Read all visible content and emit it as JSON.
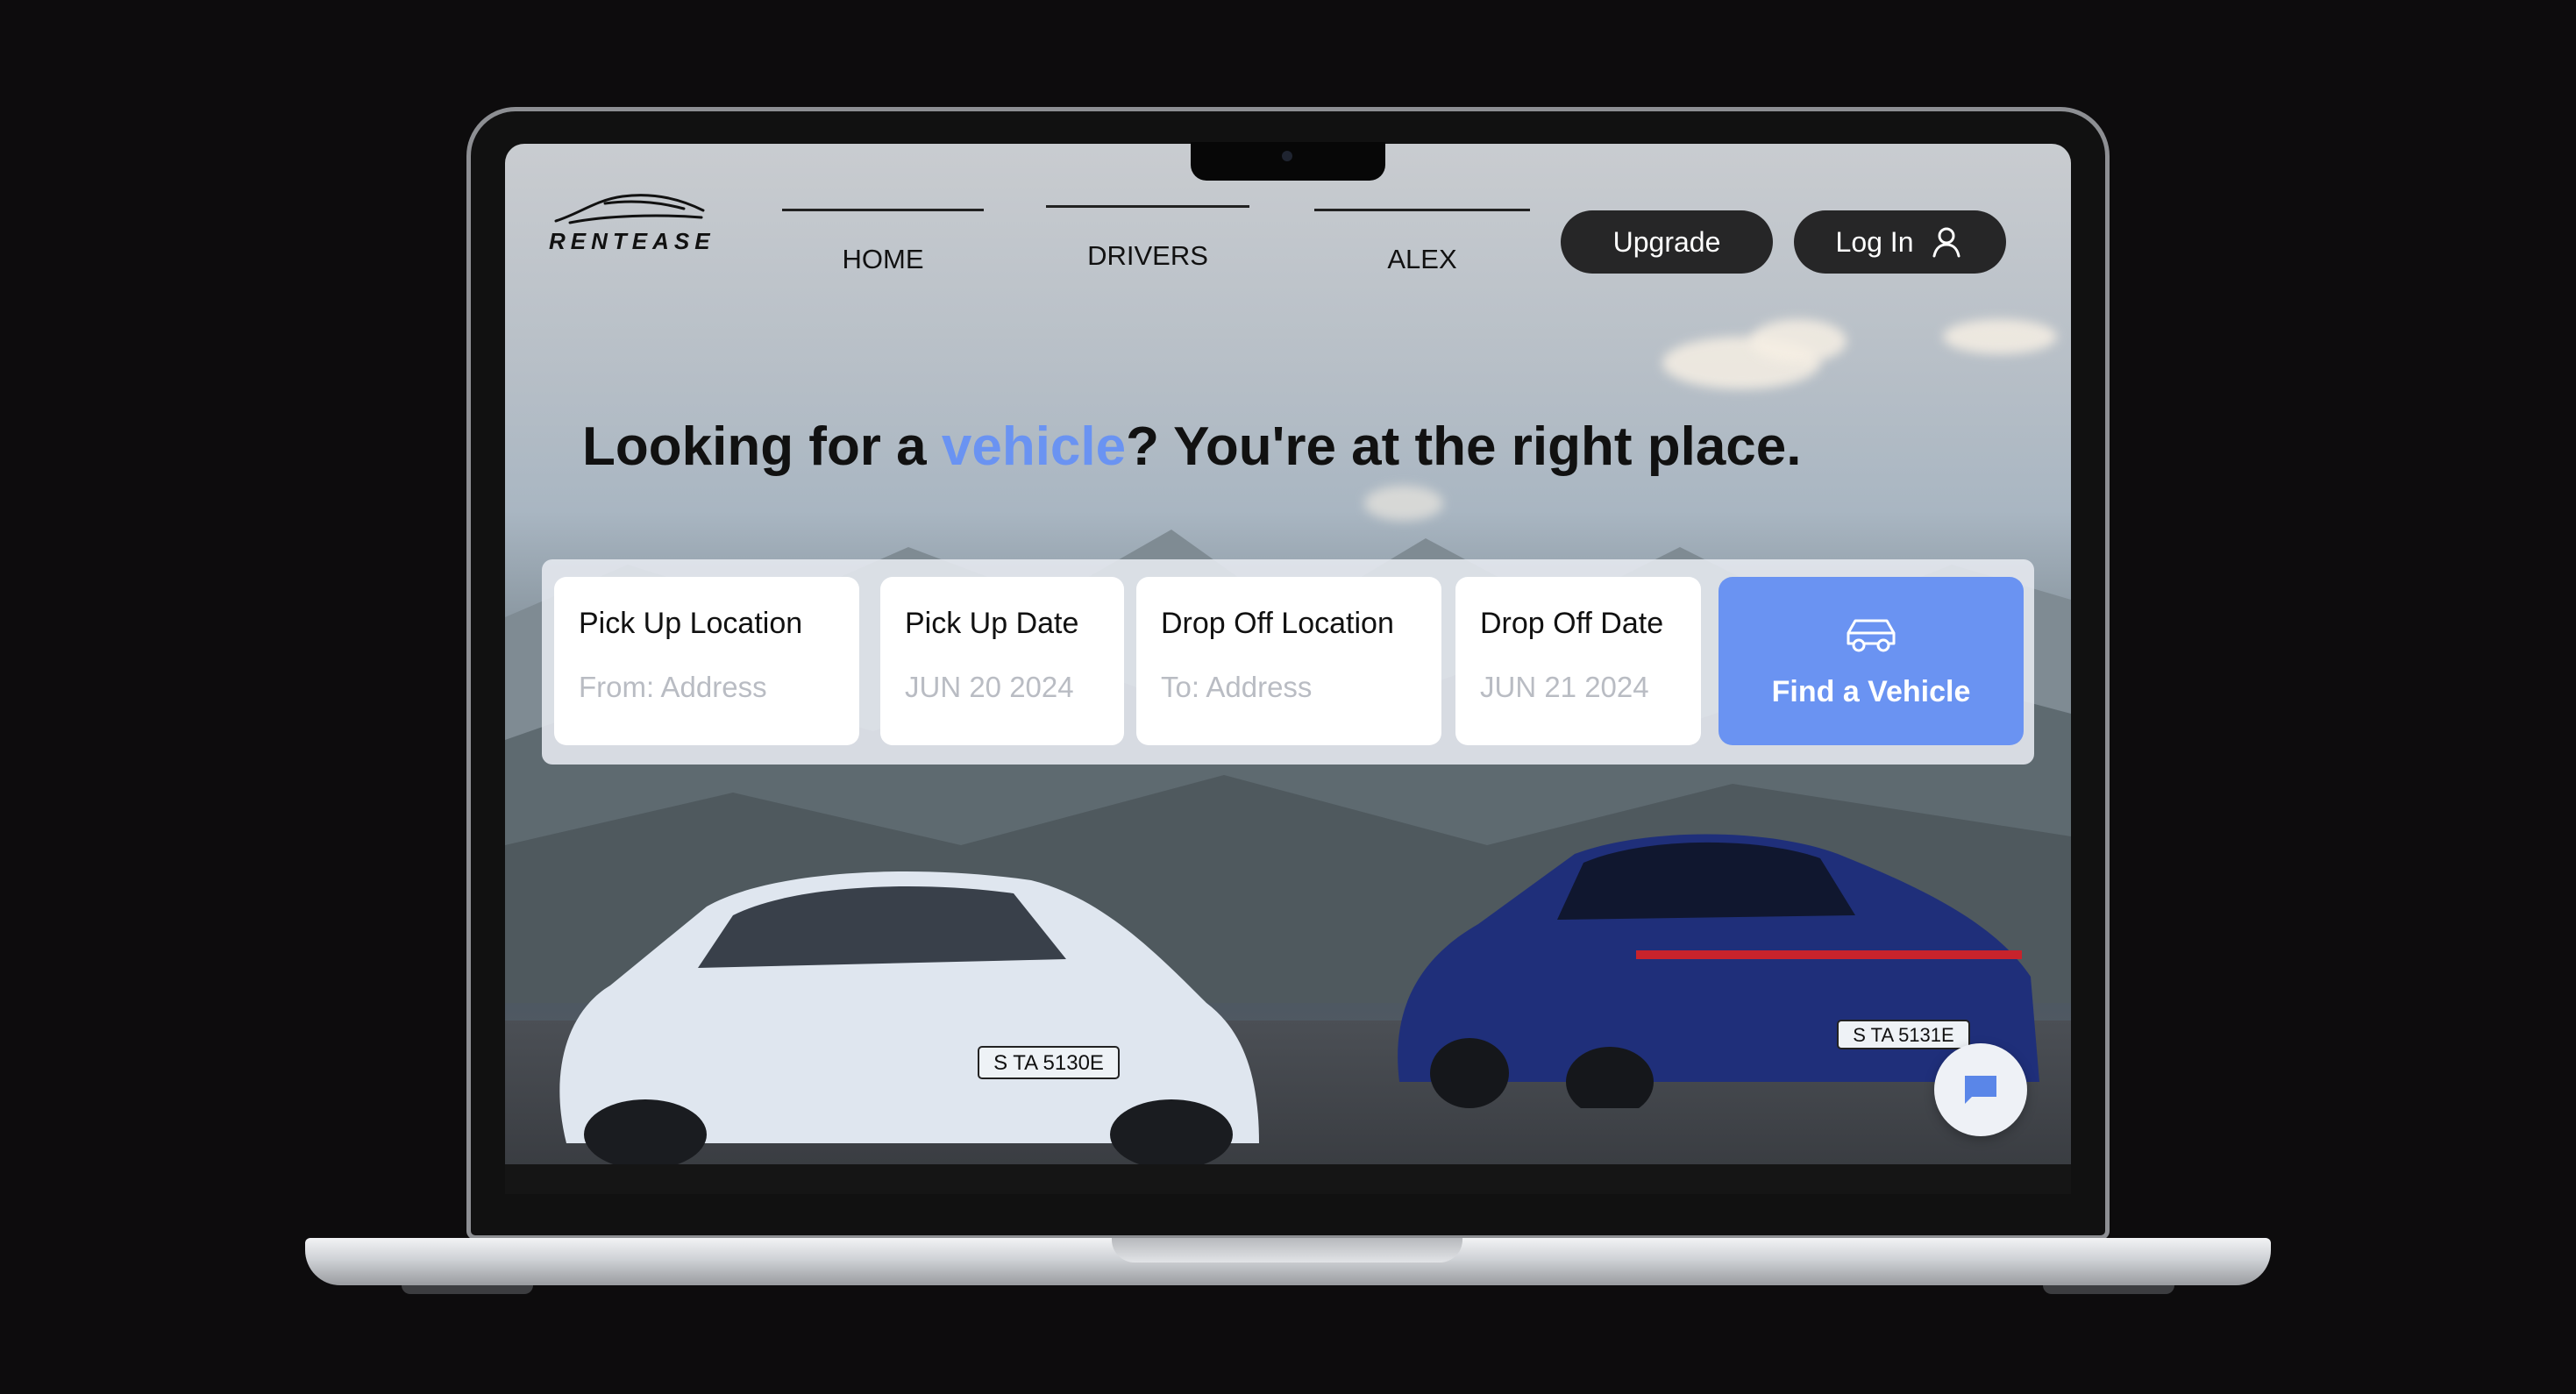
{
  "brand": {
    "name": "RENTEASE"
  },
  "nav": {
    "items": [
      {
        "label": "HOME"
      },
      {
        "label": "DRIVERS"
      },
      {
        "label": "ALEX"
      }
    ],
    "upgrade_label": "Upgrade",
    "login_label": "Log In"
  },
  "hero": {
    "headline_prefix": "Looking for a ",
    "headline_accent": "vehicle",
    "headline_suffix": "? You're at the right place."
  },
  "search": {
    "pickup_location": {
      "label": "Pick Up Location",
      "placeholder": "From: Address"
    },
    "pickup_date": {
      "label": "Pick Up Date",
      "value": "JUN 20 2024"
    },
    "dropoff_location": {
      "label": "Drop Off Location",
      "placeholder": "To: Address"
    },
    "dropoff_date": {
      "label": "Drop Off Date",
      "value": "JUN 21 2024"
    },
    "find_label": "Find a Vehicle"
  },
  "cars": {
    "left_plate": "S TA 5130E",
    "right_plate": "S TA 5131E"
  },
  "colors": {
    "accent": "#6a93f2",
    "dark_pill": "#262627",
    "field_bg": "#ffffff",
    "placeholder": "#b9bcc3"
  },
  "icons": [
    "car-logo-icon",
    "user-icon",
    "car-icon",
    "chat-icon"
  ]
}
